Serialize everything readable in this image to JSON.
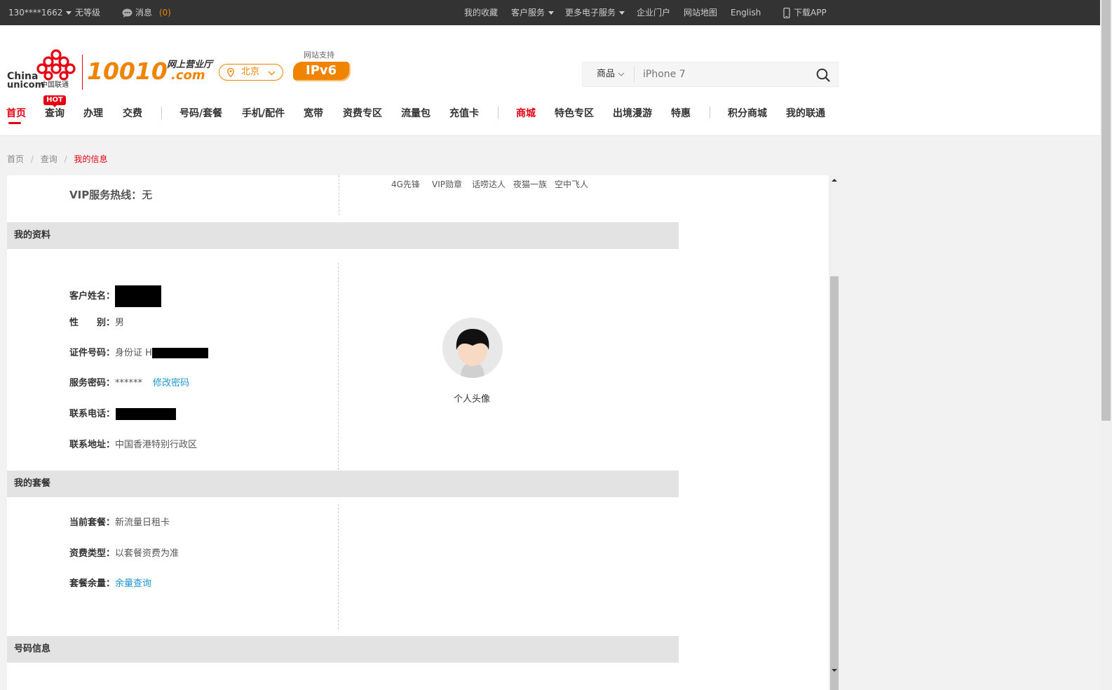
{
  "topbar": {
    "phone": "130****1662",
    "level": "无等级",
    "message_label": "消息",
    "message_count": "(0)",
    "links": [
      "我的收藏",
      "客户服务",
      "更多电子服务",
      "企业门户",
      "网站地图",
      "English",
      "下载APP"
    ]
  },
  "header": {
    "logo_en_1": "China",
    "logo_en_2": "unicom",
    "logo_cn": "中国联通",
    "brand_num": "10010",
    "brand_cn": "网上营业厅",
    "brand_com": ".com",
    "city": "北京",
    "ipv6_top": "网站支持",
    "ipv6": "IPv6",
    "search_category": "商品",
    "search_placeholder": "iPhone 7",
    "hot": "HOT",
    "nav": [
      "首页",
      "查询",
      "办理",
      "交费",
      "号码/套餐",
      "手机/配件",
      "宽带",
      "资费专区",
      "流量包",
      "充值卡",
      "商城",
      "特色专区",
      "出境漫游",
      "特惠",
      "积分商城",
      "我的联通"
    ]
  },
  "breadcrumb": {
    "home": "首页",
    "sep": "/",
    "query": "查询",
    "current": "我的信息"
  },
  "vip": {
    "hotline_label": "VIP服务热线：",
    "hotline_value": "无",
    "tags": [
      "4G先锋",
      "VIP勋章",
      "话唠达人",
      "夜猫一族",
      "空中飞人"
    ]
  },
  "profile": {
    "title": "我的资料",
    "name_label": "客户姓名：",
    "gender_label": "性　　别：",
    "gender_value": "男",
    "id_label": "证件号码：",
    "id_value": "身份证 H",
    "pwd_label": "服务密码：",
    "pwd_value": "******",
    "pwd_link": "修改密码",
    "phone_label": "联系电话：",
    "addr_label": "联系地址：",
    "addr_value": "中国香港特别行政区",
    "avatar_caption": "个人头像"
  },
  "plan": {
    "title": "我的套餐",
    "current_label": "当前套餐：",
    "current_value": "新流量日租卡",
    "fee_label": "资费类型：",
    "fee_value": "以套餐资费为准",
    "remain_label": "套餐余量：",
    "remain_link": "余量查询"
  },
  "number": {
    "title": "号码信息"
  },
  "colors": {
    "brand_red": "#e60012",
    "brand_orange": "#f08300",
    "link_blue": "#1e96d2",
    "topbar": "#333333"
  }
}
